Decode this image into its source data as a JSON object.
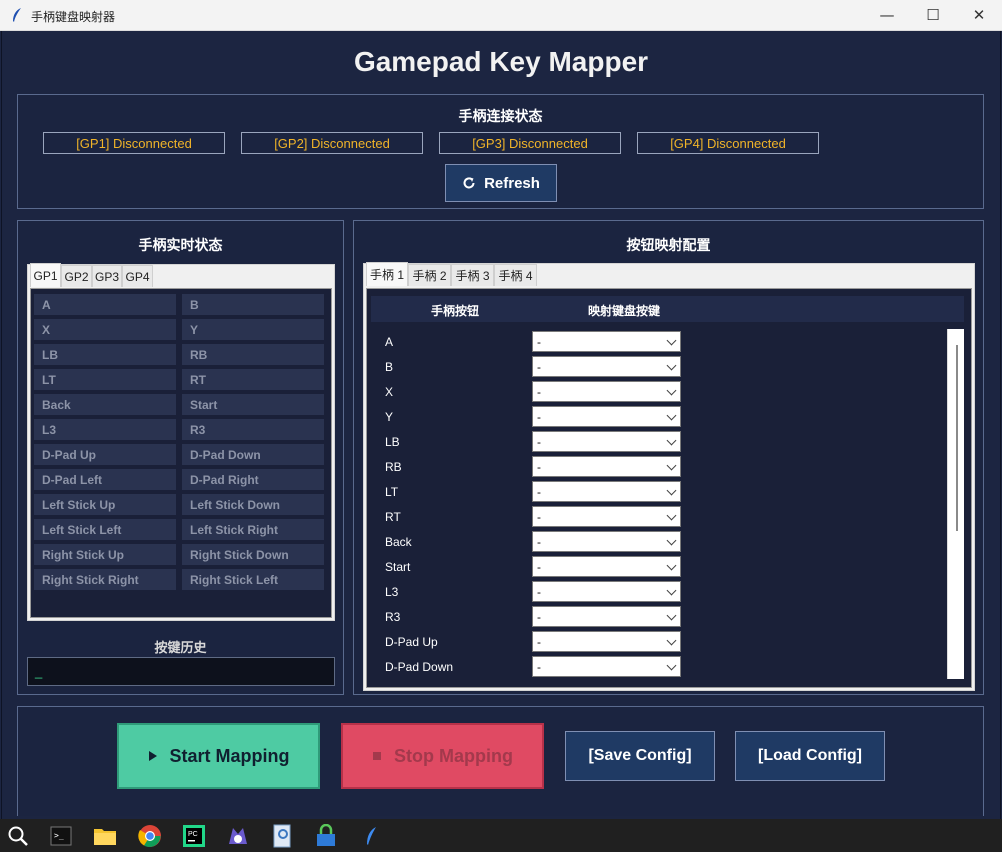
{
  "window": {
    "title": "手柄键盘映射器",
    "minimize": "—",
    "maximize": "☐",
    "close": "✕"
  },
  "app_title": "Gamepad Key Mapper",
  "connection": {
    "title": "手柄连接状态",
    "statuses": [
      "[GP1] Disconnected",
      "[GP2] Disconnected",
      "[GP3] Disconnected",
      "[GP4] Disconnected"
    ],
    "refresh_label": "Refresh"
  },
  "live_state": {
    "title": "手柄实时状态",
    "tabs": [
      "GP1",
      "GP2",
      "GP3",
      "GP4"
    ],
    "buttons": [
      [
        "A",
        "B"
      ],
      [
        "X",
        "Y"
      ],
      [
        "LB",
        "RB"
      ],
      [
        "LT",
        "RT"
      ],
      [
        "Back",
        "Start"
      ],
      [
        "L3",
        "R3"
      ],
      [
        "D-Pad Up",
        "D-Pad Down"
      ],
      [
        "D-Pad Left",
        "D-Pad Right"
      ],
      [
        "Left Stick Up",
        "Left Stick Down"
      ],
      [
        "Left Stick Left",
        "Left Stick Right"
      ],
      [
        "Right Stick Up",
        "Right Stick Down"
      ],
      [
        "Right Stick Right",
        "Right Stick Left"
      ]
    ],
    "history_title": "按键历史",
    "history_value": "_"
  },
  "mapping": {
    "title": "按钮映射配置",
    "tabs": [
      "手柄 1",
      "手柄 2",
      "手柄 3",
      "手柄 4"
    ],
    "col_button": "手柄按钮",
    "col_key": "映射键盘按键",
    "rows": [
      {
        "button": "A",
        "key": "-"
      },
      {
        "button": "B",
        "key": "-"
      },
      {
        "button": "X",
        "key": "-"
      },
      {
        "button": "Y",
        "key": "-"
      },
      {
        "button": "LB",
        "key": "-"
      },
      {
        "button": "RB",
        "key": "-"
      },
      {
        "button": "LT",
        "key": "-"
      },
      {
        "button": "RT",
        "key": "-"
      },
      {
        "button": "Back",
        "key": "-"
      },
      {
        "button": "Start",
        "key": "-"
      },
      {
        "button": "L3",
        "key": "-"
      },
      {
        "button": "R3",
        "key": "-"
      },
      {
        "button": "D-Pad Up",
        "key": "-"
      },
      {
        "button": "D-Pad Down",
        "key": "-"
      }
    ]
  },
  "actions": {
    "start": "Start Mapping",
    "stop": "Stop Mapping",
    "save": "[Save Config]",
    "load": "[Load Config]"
  },
  "colors": {
    "start_bg": "#4ecba3",
    "stop_bg": "#e04a63",
    "status_text": "#f0b429",
    "accent_button": "#1f3a64"
  },
  "taskbar_icons": [
    "search-icon",
    "terminal-icon",
    "file-explorer-icon",
    "chrome-icon",
    "pycharm-icon",
    "app-icon",
    "image-viewer-icon",
    "security-app-icon",
    "feather-app-icon"
  ]
}
